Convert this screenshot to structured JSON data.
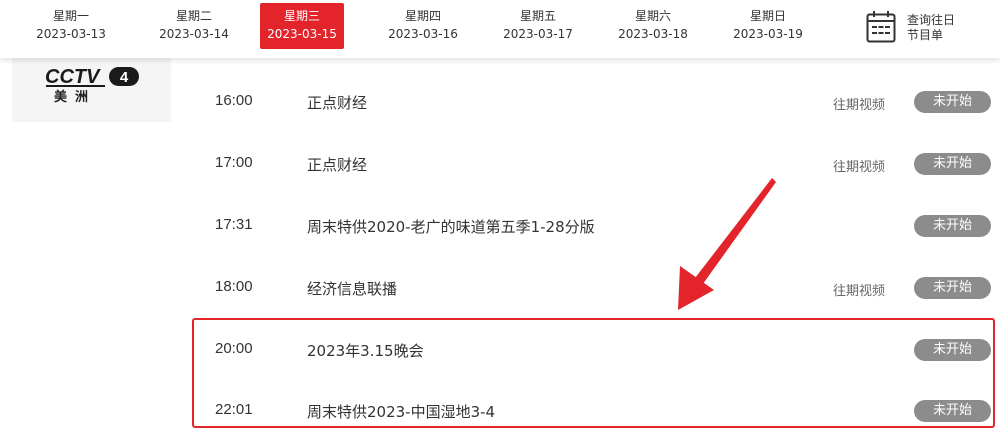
{
  "date_bar": {
    "days": [
      {
        "weekday": "星期一",
        "date": "2023-03-13",
        "active": false
      },
      {
        "weekday": "星期二",
        "date": "2023-03-14",
        "active": false
      },
      {
        "weekday": "星期三",
        "date": "2023-03-15",
        "active": true
      },
      {
        "weekday": "星期四",
        "date": "2023-03-16",
        "active": false
      },
      {
        "weekday": "星期五",
        "date": "2023-03-17",
        "active": false
      },
      {
        "weekday": "星期六",
        "date": "2023-03-18",
        "active": false
      },
      {
        "weekday": "星期日",
        "date": "2023-03-19",
        "active": false
      }
    ],
    "query_label_line1": "查询往日",
    "query_label_line2": "节目单",
    "query_icon": "calendar-icon"
  },
  "channel": {
    "logo_text": "CCTV",
    "logo_number": "4",
    "region": "美洲"
  },
  "schedule": [
    {
      "time": "16:00",
      "title": "正点财经",
      "replay": "往期视频",
      "status": "未开始"
    },
    {
      "time": "17:00",
      "title": "正点财经",
      "replay": "往期视频",
      "status": "未开始"
    },
    {
      "time": "17:31",
      "title": "周末特供2020-老广的味道第五季1-28分版",
      "replay": "",
      "status": "未开始"
    },
    {
      "time": "18:00",
      "title": "经济信息联播",
      "replay": "往期视频",
      "status": "未开始"
    },
    {
      "time": "20:00",
      "title": "2023年3.15晚会",
      "replay": "",
      "status": "未开始"
    },
    {
      "time": "22:01",
      "title": "周末特供2023-中国湿地3-4",
      "replay": "",
      "status": "未开始"
    }
  ],
  "colors": {
    "accent": "#e3242b",
    "status_badge": "#8c8c8c"
  }
}
